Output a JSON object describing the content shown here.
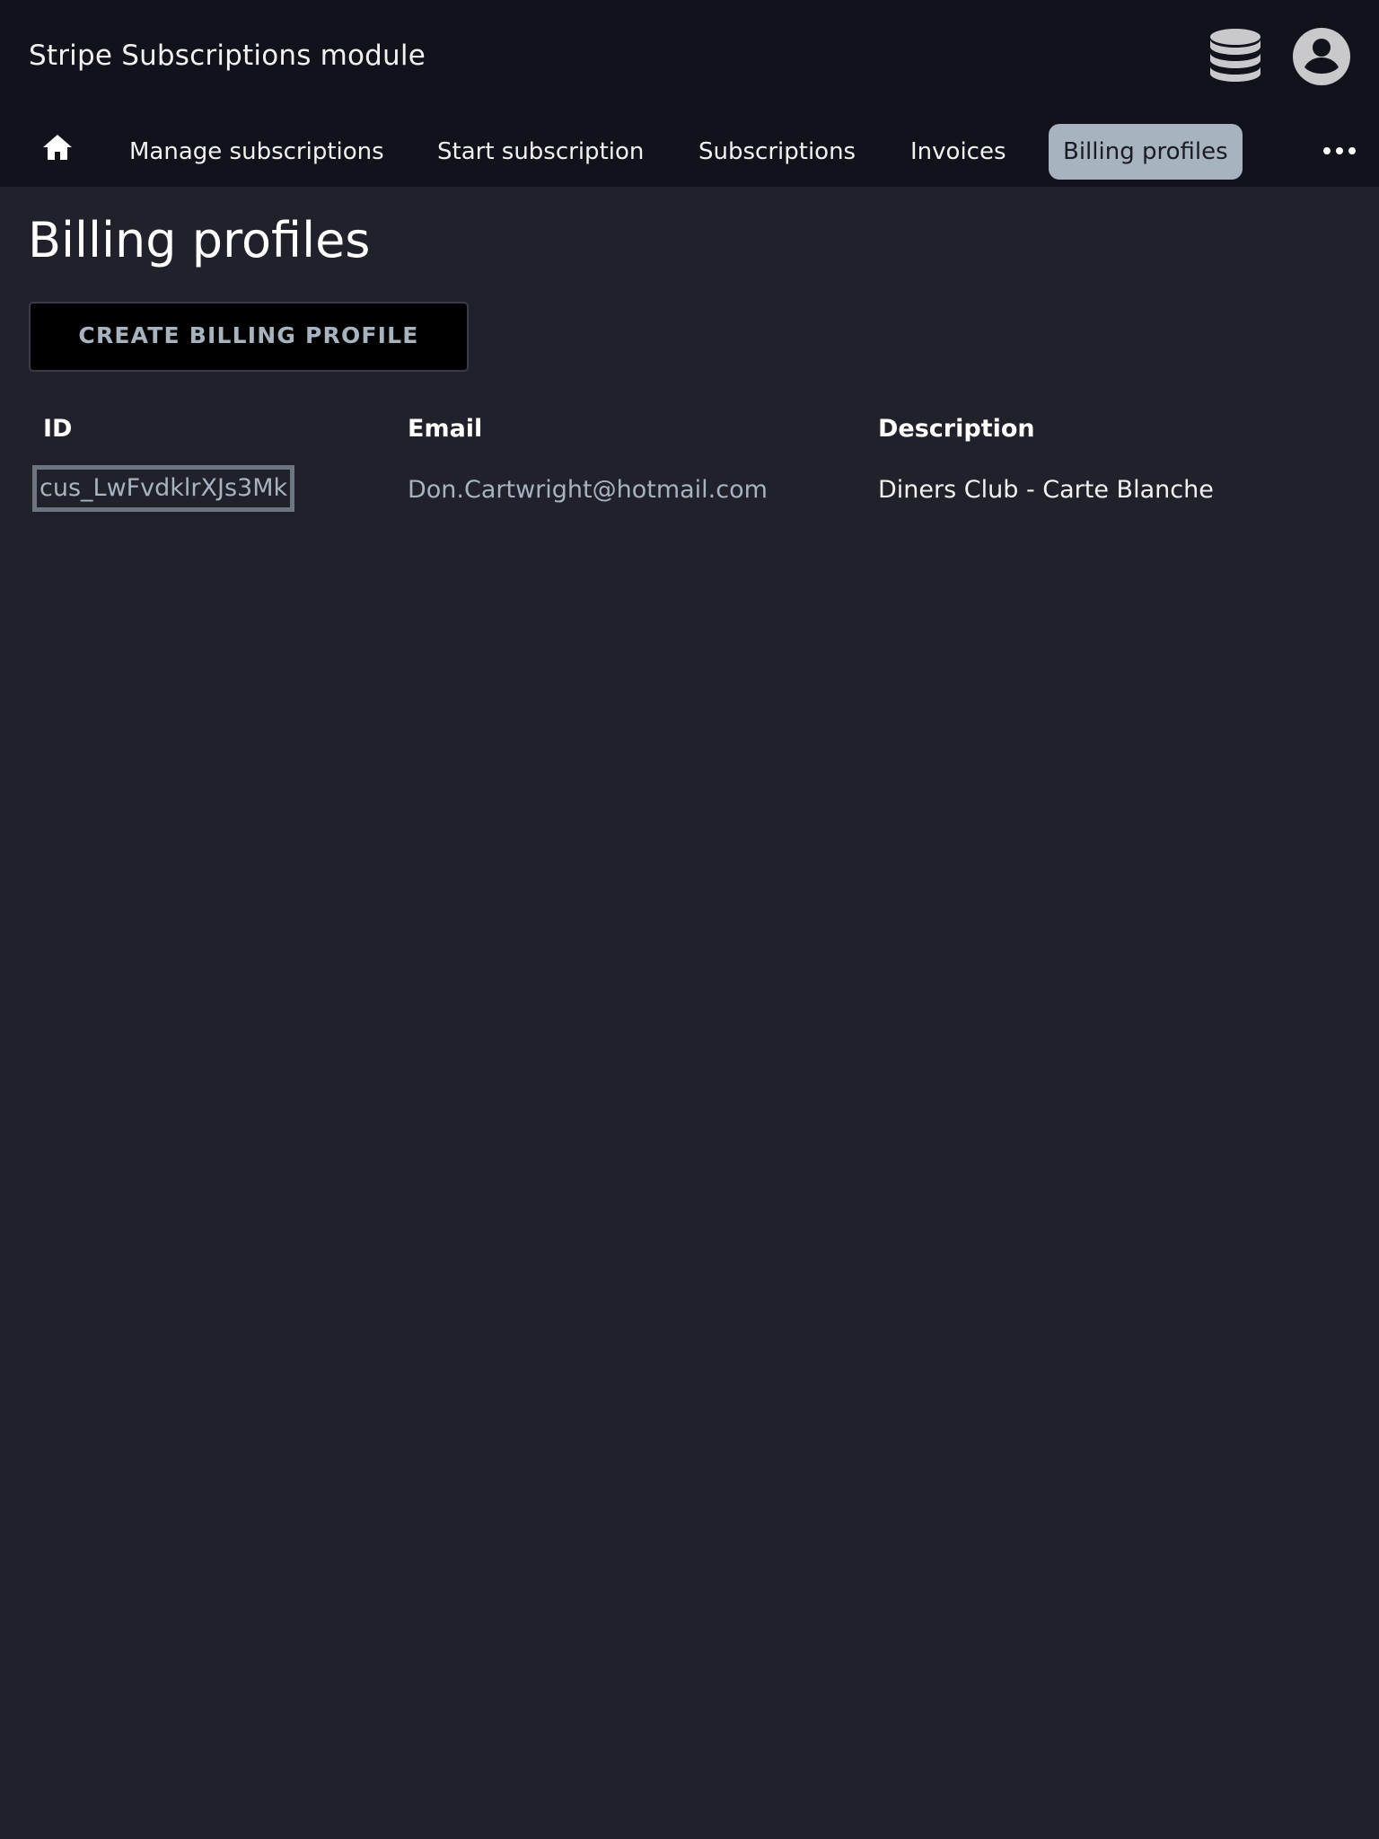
{
  "header": {
    "title": "Stripe Subscriptions module",
    "icons": [
      "database-icon",
      "account-circle-icon"
    ]
  },
  "nav": {
    "home_icon": "home-icon",
    "items": [
      {
        "label": "Manage subscriptions",
        "active": false
      },
      {
        "label": "Start subscription",
        "active": false
      },
      {
        "label": "Subscriptions",
        "active": false
      },
      {
        "label": "Invoices",
        "active": false
      },
      {
        "label": "Billing profiles",
        "active": true
      }
    ],
    "more_icon": "more-horizontal-icon",
    "active_color": "#a8b3c0"
  },
  "main": {
    "page_title": "Billing profiles",
    "create_button": "CREATE BILLING PROFILE",
    "table": {
      "columns": [
        "ID",
        "Email",
        "Description"
      ],
      "rows": [
        {
          "id": "cus_LwFvdklrXJs3Mk",
          "email": "Don.Cartwright@hotmail.com",
          "description": "Diners Club - Carte Blanche"
        }
      ]
    }
  },
  "colors": {
    "background": "#20212a",
    "header_background": "#11121b",
    "muted_text": "#a8b3c0"
  }
}
